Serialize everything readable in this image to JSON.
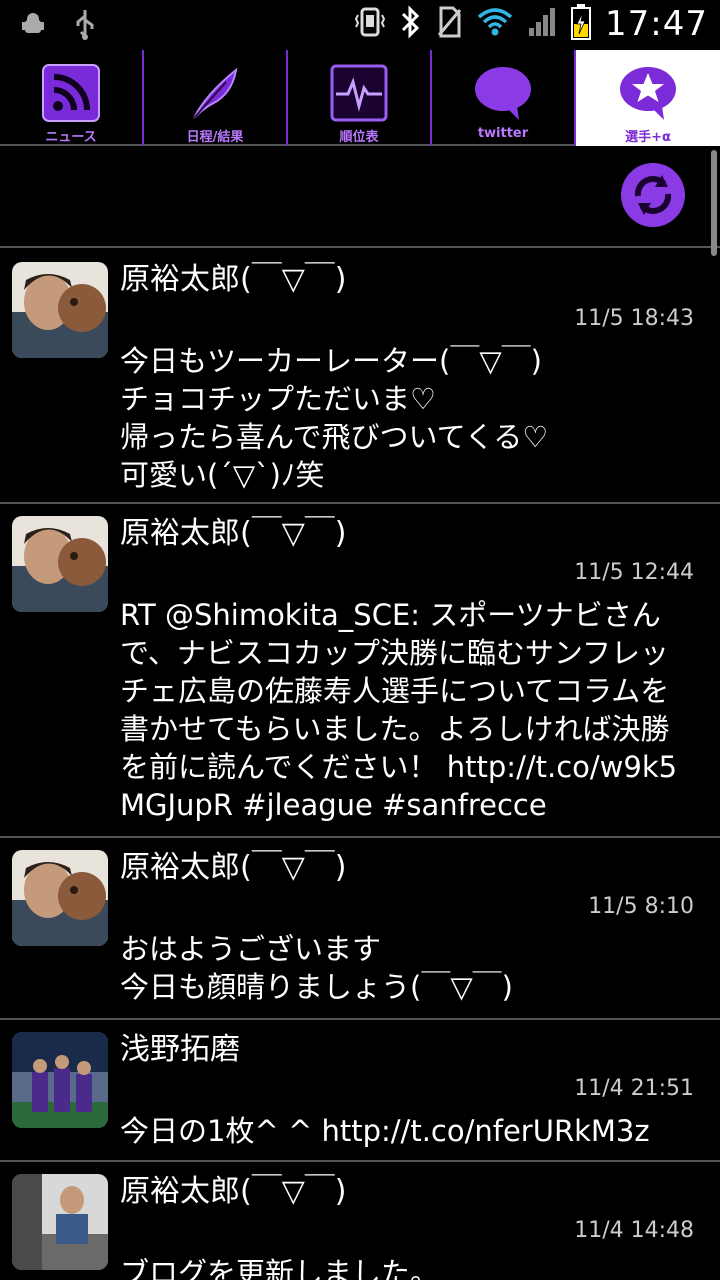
{
  "status_bar": {
    "time": "17:47",
    "left_icons": [
      "android-debug-icon",
      "usb-icon"
    ],
    "right_icons": [
      "vibrate-icon",
      "bluetooth-icon",
      "no-sim-icon",
      "wifi-icon",
      "signal-icon",
      "battery-charging-icon"
    ]
  },
  "tabs": [
    {
      "label": "ニュース",
      "icon": "rss-icon",
      "active": false
    },
    {
      "label": "日程/結果",
      "icon": "feather-icon",
      "active": false
    },
    {
      "label": "順位表",
      "icon": "pulse-chart-icon",
      "active": false
    },
    {
      "label": "twitter",
      "icon": "speech-bubble-icon",
      "active": false
    },
    {
      "label": "選手+α",
      "icon": "star-bubble-icon",
      "active": true
    }
  ],
  "colors": {
    "accent": "#8a2be2",
    "background": "#000000",
    "divider": "#555555"
  },
  "tweets": [
    {
      "name": "原裕太郎(￣▽￣)",
      "time": "11/5 18:43",
      "body": "今日もツーカーレーター(￣▽￣)\nチョコチップただいま♡\n帰ったら喜んで飛びついてくる♡\n可愛い(´▽`)ﾉ笑"
    },
    {
      "name": "原裕太郎(￣▽￣)",
      "time": "11/5 12:44",
      "body": "RT @Shimokita_SCE: スポーツナビさんで、ナビスコカップ決勝に臨むサンフレッチェ広島の佐藤寿人選手についてコラムを書かせてもらいました。よろしければ決勝を前に読んでください！ http://t.co/w9k5MGJupR #jleague #sanfrecce"
    },
    {
      "name": "原裕太郎(￣▽￣)",
      "time": "11/5 8:10",
      "body": "おはようございます\n今日も顔晴りましょう(￣▽￣)"
    },
    {
      "name": "浅野拓磨",
      "time": "11/4 21:51",
      "body": "今日の1枚^ ^ http://t.co/nferURkM3z"
    },
    {
      "name": "原裕太郎(￣▽￣)",
      "time": "11/4 14:48",
      "body": "ブログを更新しました。"
    }
  ]
}
